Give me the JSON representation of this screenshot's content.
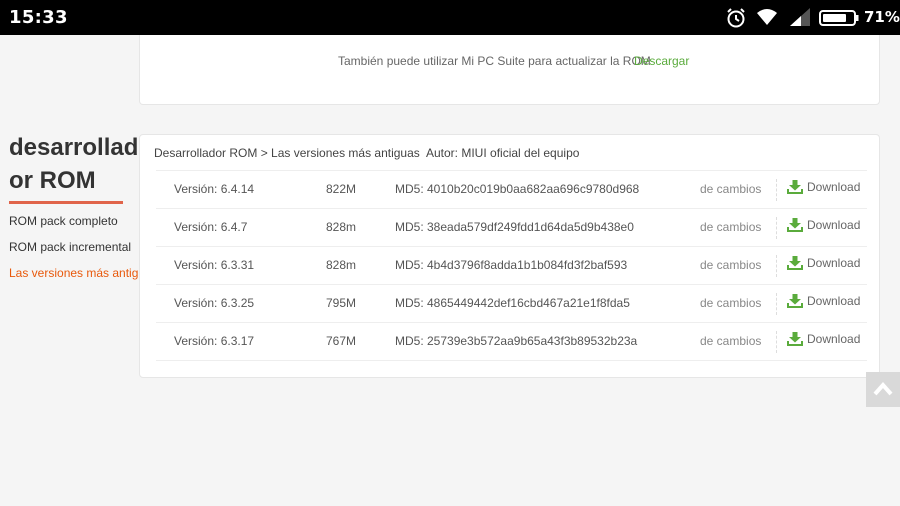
{
  "status_bar": {
    "time": "15:33",
    "battery_percent": "71%",
    "icons": [
      "alarm-icon",
      "wifi-icon",
      "signal-icon",
      "battery-icon"
    ]
  },
  "top_card": {
    "note": "También puede utilizar Mi PC Suite para actualizar la ROM",
    "download_link": "Descargar"
  },
  "sidebar": {
    "title": "desarrollador ROM",
    "items": [
      {
        "label": "ROM pack completo",
        "active": false
      },
      {
        "label": "ROM pack incremental",
        "active": false
      },
      {
        "label": "Las versiones más antiguas",
        "active": true
      }
    ]
  },
  "main_card": {
    "breadcrumb": "Desarrollador ROM > Las versiones más antiguas",
    "author": "Autor: MIUI oficial del equipo",
    "rows": [
      {
        "version": "Versión: 6.4.14",
        "size": "822M",
        "md5": "MD5: 4010b20c019b0aa682aa696c9780d968",
        "changes": "de cambios",
        "download": "Download"
      },
      {
        "version": "Versión: 6.4.7",
        "size": "828m",
        "md5": "MD5: 38eada579df249fdd1d64da5d9b438e0",
        "changes": "de cambios",
        "download": "Download"
      },
      {
        "version": "Versión: 6.3.31",
        "size": "828m",
        "md5": "MD5: 4b4d3796f8adda1b1b084fd3f2baf593",
        "changes": "de cambios",
        "download": "Download"
      },
      {
        "version": "Versión: 6.3.25",
        "size": "795M",
        "md5": "MD5: 4865449442def16cbd467a21e1f8fda5",
        "changes": "de cambios",
        "download": "Download"
      },
      {
        "version": "Versión: 6.3.17",
        "size": "767M",
        "md5": "MD5: 25739e3b572aa9b65a43f3b89532b23a",
        "changes": "de cambios",
        "download": "Download"
      }
    ]
  },
  "colors": {
    "accent_orange": "#e8590c",
    "download_green": "#5aab3c",
    "underline": "#e0644a"
  },
  "back_to_top_icon": "chevron-up-icon"
}
